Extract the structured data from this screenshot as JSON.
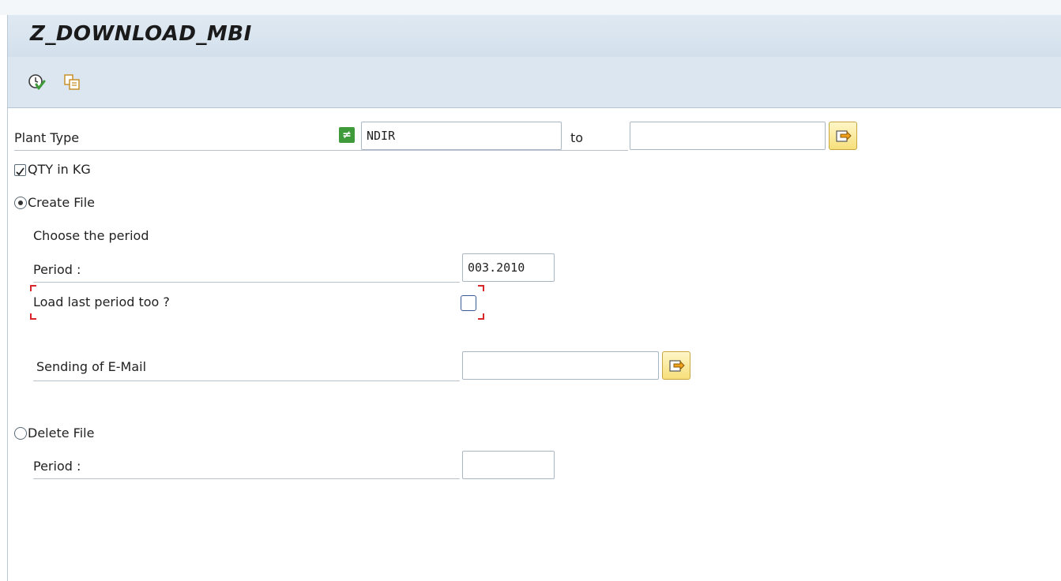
{
  "window": {
    "title": "Z_DOWNLOAD_MBI"
  },
  "toolbar": {
    "execute_icon": "execute-clock-icon",
    "variant_icon": "get-variant-icon"
  },
  "selection": {
    "plant_type": {
      "label": "Plant Type",
      "op_icon": "≠",
      "from_value": "NDIR",
      "to_label": "to",
      "to_value": ""
    },
    "qty_kg": {
      "label": "QTY in KG",
      "checked": true
    },
    "create_file": {
      "label": "Create File",
      "selected": true
    },
    "choose_period": "Choose the period",
    "period": {
      "label": "Period :",
      "value": "003.2010"
    },
    "load_last": {
      "label": "Load last period too ?",
      "checked": false
    },
    "email": {
      "label": "Sending of E-Mail",
      "value": ""
    },
    "delete_file": {
      "label": "Delete File",
      "selected": false
    },
    "delete_period": {
      "label": "Period :",
      "value": ""
    }
  },
  "colors": {
    "titlebar": "#d3e0ec",
    "toolbar": "#dbe6f0",
    "green": "#3f9a3a",
    "accent_yellow": "#f6df7a",
    "focus_red": "#d9262b"
  }
}
